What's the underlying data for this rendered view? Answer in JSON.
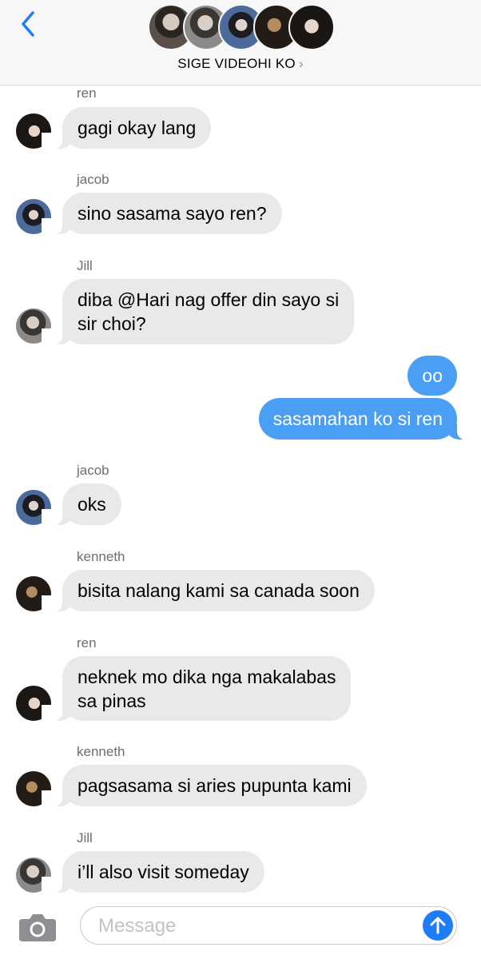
{
  "header": {
    "group_name": "SIGE VIDEOHI KO",
    "chevron": "›",
    "back_icon": "chevron-left-icon",
    "participants": [
      "ren",
      "Jill",
      "jacob",
      "kenneth",
      "member-5"
    ]
  },
  "messages": [
    {
      "sender": "ren",
      "text": "gagi okay lang",
      "direction": "incoming"
    },
    {
      "sender": "jacob",
      "text": "sino sasama sayo ren?",
      "direction": "incoming"
    },
    {
      "sender": "Jill",
      "line1": "diba @Hari nag offer din sayo si",
      "line2": "sir choi?",
      "direction": "incoming"
    },
    {
      "text": "oo",
      "direction": "outgoing"
    },
    {
      "text": "sasamahan ko si ren",
      "direction": "outgoing"
    },
    {
      "sender": "jacob",
      "text": "oks",
      "direction": "incoming"
    },
    {
      "sender": "kenneth",
      "text": "bisita nalang kami sa canada soon",
      "direction": "incoming"
    },
    {
      "sender": "ren",
      "line1": "neknek mo dika nga makalabas",
      "line2": "sa pinas",
      "direction": "incoming"
    },
    {
      "sender": "kenneth",
      "text": "pagsasama si aries pupunta kami",
      "direction": "incoming"
    },
    {
      "sender": "Jill",
      "text": "i’ll also visit someday",
      "direction": "incoming"
    }
  ],
  "input": {
    "placeholder": "Message",
    "value": "",
    "camera_icon": "camera-icon",
    "send_icon": "arrow-up-icon"
  },
  "colors": {
    "accent": "#1f7cf7",
    "outgoing_bubble": "#4a9ff5",
    "incoming_bubble": "#e9e9eb",
    "header_bg": "#f7f7f7",
    "sender_label": "#6d6d72"
  }
}
